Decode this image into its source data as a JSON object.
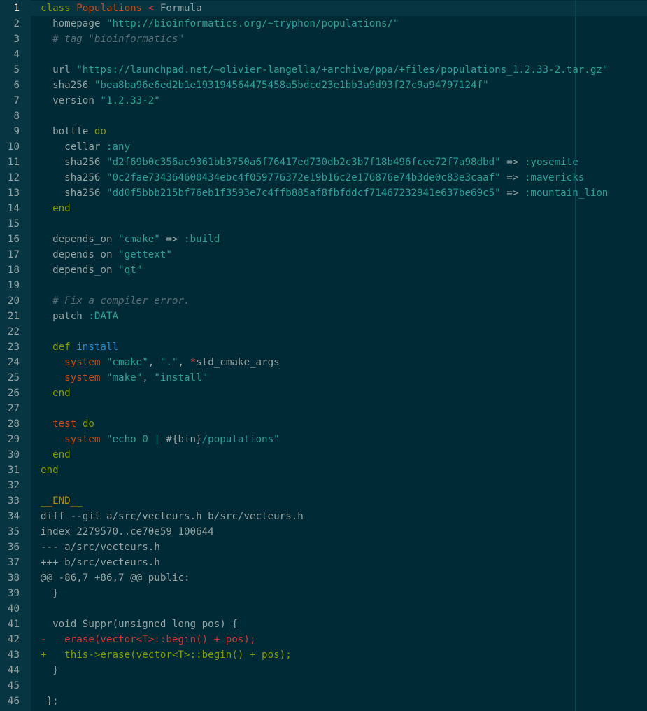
{
  "editor": {
    "active_line": 1,
    "lines": [
      {
        "n": "1",
        "tokens": [
          {
            "t": "class ",
            "c": "keyword"
          },
          {
            "t": "Populations",
            "c": "orange"
          },
          {
            "t": " < ",
            "c": "red"
          },
          {
            "t": "Formula",
            "c": "plain"
          }
        ]
      },
      {
        "n": "2",
        "tokens": [
          {
            "t": "  homepage ",
            "c": "plain"
          },
          {
            "t": "\"http://bioinformatics.org/~tryphon/populations/\"",
            "c": "string"
          }
        ]
      },
      {
        "n": "3",
        "tokens": [
          {
            "t": "  # tag \"bioinformatics\"",
            "c": "comment"
          }
        ]
      },
      {
        "n": "4",
        "tokens": []
      },
      {
        "n": "5",
        "tokens": [
          {
            "t": "  url ",
            "c": "plain"
          },
          {
            "t": "\"https://launchpad.net/~olivier-langella/+archive/ppa/+files/populations_1.2.33-2.tar.gz\"",
            "c": "string"
          }
        ]
      },
      {
        "n": "6",
        "tokens": [
          {
            "t": "  sha256 ",
            "c": "plain"
          },
          {
            "t": "\"bea8ba96e6ed2b1e193194564475458a5bdcd23e1bb3a9d93f27c9a94797124f\"",
            "c": "string"
          }
        ]
      },
      {
        "n": "7",
        "tokens": [
          {
            "t": "  version ",
            "c": "plain"
          },
          {
            "t": "\"1.2.33-2\"",
            "c": "string"
          }
        ]
      },
      {
        "n": "8",
        "tokens": []
      },
      {
        "n": "9",
        "tokens": [
          {
            "t": "  bottle ",
            "c": "plain"
          },
          {
            "t": "do",
            "c": "keyword"
          }
        ]
      },
      {
        "n": "10",
        "tokens": [
          {
            "t": "    cellar ",
            "c": "plain"
          },
          {
            "t": ":any",
            "c": "symbol"
          }
        ]
      },
      {
        "n": "11",
        "tokens": [
          {
            "t": "    sha256 ",
            "c": "plain"
          },
          {
            "t": "\"d2f69b0c356ac9361bb3750a6f76417ed730db2c3b7f18b496fcee72f7a98dbd\"",
            "c": "string"
          },
          {
            "t": " => ",
            "c": "plain"
          },
          {
            "t": ":yosemite",
            "c": "symbol"
          }
        ]
      },
      {
        "n": "12",
        "tokens": [
          {
            "t": "    sha256 ",
            "c": "plain"
          },
          {
            "t": "\"0c2fae734364600434ebc4f059776372e19b16c2e176876e74b3de0c83e3caaf\"",
            "c": "string"
          },
          {
            "t": " => ",
            "c": "plain"
          },
          {
            "t": ":mavericks",
            "c": "symbol"
          }
        ]
      },
      {
        "n": "13",
        "tokens": [
          {
            "t": "    sha256 ",
            "c": "plain"
          },
          {
            "t": "\"dd0f5bbb215bf76eb1f3593e7c4ffb885af8fbfddcf71467232941e637be69c5\"",
            "c": "string"
          },
          {
            "t": " => ",
            "c": "plain"
          },
          {
            "t": ":mountain_lion",
            "c": "symbol"
          }
        ]
      },
      {
        "n": "14",
        "tokens": [
          {
            "t": "  ",
            "c": "plain"
          },
          {
            "t": "end",
            "c": "keyword"
          }
        ]
      },
      {
        "n": "15",
        "tokens": []
      },
      {
        "n": "16",
        "tokens": [
          {
            "t": "  depends_on ",
            "c": "plain"
          },
          {
            "t": "\"cmake\"",
            "c": "string"
          },
          {
            "t": " => ",
            "c": "plain"
          },
          {
            "t": ":build",
            "c": "symbol"
          }
        ]
      },
      {
        "n": "17",
        "tokens": [
          {
            "t": "  depends_on ",
            "c": "plain"
          },
          {
            "t": "\"gettext\"",
            "c": "string"
          }
        ]
      },
      {
        "n": "18",
        "tokens": [
          {
            "t": "  depends_on ",
            "c": "plain"
          },
          {
            "t": "\"qt\"",
            "c": "string"
          }
        ]
      },
      {
        "n": "19",
        "tokens": []
      },
      {
        "n": "20",
        "tokens": [
          {
            "t": "  # Fix a compiler error.",
            "c": "comment"
          }
        ]
      },
      {
        "n": "21",
        "tokens": [
          {
            "t": "  patch ",
            "c": "plain"
          },
          {
            "t": ":DATA",
            "c": "symbol"
          }
        ]
      },
      {
        "n": "22",
        "tokens": []
      },
      {
        "n": "23",
        "tokens": [
          {
            "t": "  ",
            "c": "plain"
          },
          {
            "t": "def ",
            "c": "keyword"
          },
          {
            "t": "install",
            "c": "blue"
          }
        ]
      },
      {
        "n": "24",
        "tokens": [
          {
            "t": "    ",
            "c": "plain"
          },
          {
            "t": "system",
            "c": "orange"
          },
          {
            "t": " ",
            "c": "plain"
          },
          {
            "t": "\"cmake\"",
            "c": "string"
          },
          {
            "t": ", ",
            "c": "plain"
          },
          {
            "t": "\".\"",
            "c": "string"
          },
          {
            "t": ", ",
            "c": "plain"
          },
          {
            "t": "*",
            "c": "red"
          },
          {
            "t": "std_cmake_args",
            "c": "plain"
          }
        ]
      },
      {
        "n": "25",
        "tokens": [
          {
            "t": "    ",
            "c": "plain"
          },
          {
            "t": "system",
            "c": "orange"
          },
          {
            "t": " ",
            "c": "plain"
          },
          {
            "t": "\"make\"",
            "c": "string"
          },
          {
            "t": ", ",
            "c": "plain"
          },
          {
            "t": "\"install\"",
            "c": "string"
          }
        ]
      },
      {
        "n": "26",
        "tokens": [
          {
            "t": "  ",
            "c": "plain"
          },
          {
            "t": "end",
            "c": "keyword"
          }
        ]
      },
      {
        "n": "27",
        "tokens": []
      },
      {
        "n": "28",
        "tokens": [
          {
            "t": "  ",
            "c": "plain"
          },
          {
            "t": "test",
            "c": "orange"
          },
          {
            "t": " ",
            "c": "plain"
          },
          {
            "t": "do",
            "c": "keyword"
          }
        ]
      },
      {
        "n": "29",
        "tokens": [
          {
            "t": "    ",
            "c": "plain"
          },
          {
            "t": "system",
            "c": "orange"
          },
          {
            "t": " ",
            "c": "plain"
          },
          {
            "t": "\"echo 0 | ",
            "c": "string"
          },
          {
            "t": "#{bin}",
            "c": "plain"
          },
          {
            "t": "/populations\"",
            "c": "string"
          }
        ]
      },
      {
        "n": "30",
        "tokens": [
          {
            "t": "  ",
            "c": "plain"
          },
          {
            "t": "end",
            "c": "keyword"
          }
        ]
      },
      {
        "n": "31",
        "tokens": [
          {
            "t": "end",
            "c": "keyword"
          }
        ]
      },
      {
        "n": "32",
        "tokens": []
      },
      {
        "n": "33",
        "tokens": [
          {
            "t": "__END__",
            "c": "yellow"
          }
        ]
      },
      {
        "n": "34",
        "tokens": [
          {
            "t": "diff --git a/src/vecteurs.h b/src/vecteurs.h",
            "c": "plain"
          }
        ]
      },
      {
        "n": "35",
        "tokens": [
          {
            "t": "index 2279570..ce70e59 100644",
            "c": "plain"
          }
        ]
      },
      {
        "n": "36",
        "tokens": [
          {
            "t": "--- a/src/vecteurs.h",
            "c": "plain"
          }
        ]
      },
      {
        "n": "37",
        "tokens": [
          {
            "t": "+++ b/src/vecteurs.h",
            "c": "plain"
          }
        ]
      },
      {
        "n": "38",
        "tokens": [
          {
            "t": "@@ -86,7 +86,7 @@ public:",
            "c": "plain"
          }
        ]
      },
      {
        "n": "39",
        "tokens": [
          {
            "t": "  }",
            "c": "plain"
          }
        ]
      },
      {
        "n": "40",
        "tokens": []
      },
      {
        "n": "41",
        "tokens": [
          {
            "t": "  void Suppr(unsigned long pos) {",
            "c": "plain"
          }
        ]
      },
      {
        "n": "42",
        "tokens": [
          {
            "t": "-   erase(vector<T>::begin() + pos);",
            "c": "deleted"
          }
        ]
      },
      {
        "n": "43",
        "tokens": [
          {
            "t": "+   this->erase(vector<T>::begin() + pos);",
            "c": "inserted"
          }
        ]
      },
      {
        "n": "44",
        "tokens": [
          {
            "t": "  }",
            "c": "plain"
          }
        ]
      },
      {
        "n": "45",
        "tokens": []
      },
      {
        "n": "46",
        "tokens": [
          {
            "t": " };",
            "c": "plain"
          }
        ]
      }
    ]
  }
}
